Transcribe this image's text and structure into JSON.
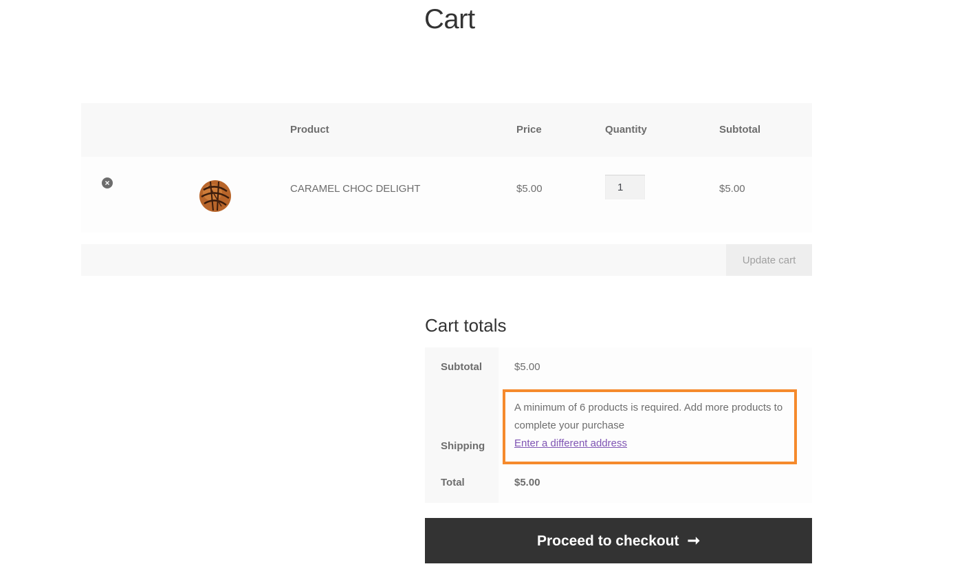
{
  "page": {
    "title": "Cart"
  },
  "cart": {
    "columns": {
      "product": "Product",
      "price": "Price",
      "quantity": "Quantity",
      "subtotal": "Subtotal"
    },
    "items": [
      {
        "name": "CARAMEL CHOC DELIGHT",
        "price": "$5.00",
        "quantity": "1",
        "subtotal": "$5.00",
        "remove_icon": "remove-circle-icon",
        "thumbnail": "chocolate-caramel-ball"
      }
    ],
    "update_label": "Update cart"
  },
  "totals": {
    "title": "Cart totals",
    "subtotal_label": "Subtotal",
    "subtotal_value": "$5.00",
    "shipping_label": "Shipping",
    "shipping_message": "A minimum of 6 products is required. Add more products to complete your purchase",
    "shipping_link": "Enter a different address",
    "total_label": "Total",
    "total_value": "$5.00",
    "checkout_label": "Proceed to checkout",
    "checkout_icon": "arrow-right-icon"
  },
  "colors": {
    "highlight_border": "#f58a2c",
    "link": "#7f54b3",
    "checkout_bg": "#333333"
  }
}
